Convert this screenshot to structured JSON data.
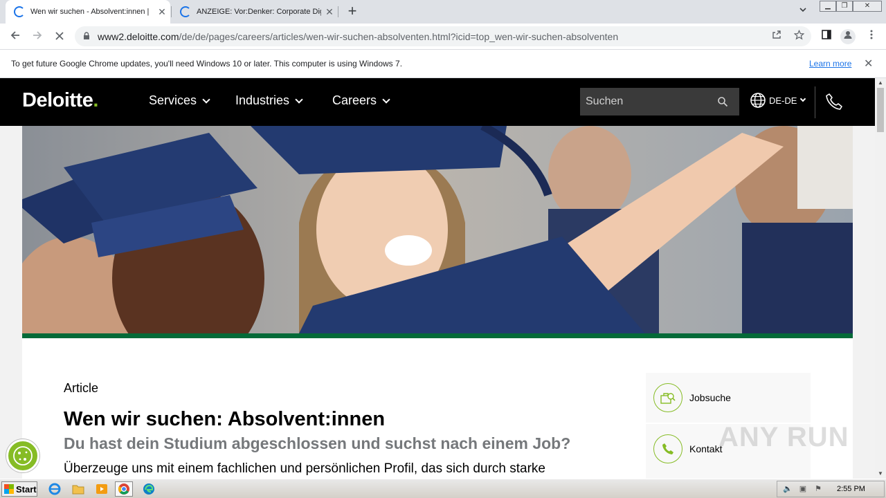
{
  "browser": {
    "tabs": [
      {
        "title": "Wen wir suchen - Absolvent:innen | ",
        "close": "✕"
      },
      {
        "title": "ANZEIGE: Vor:Denker: Corporate Dig",
        "close": "✕"
      }
    ],
    "new_tab": "+",
    "url_host": "www2.deloitte.com",
    "url_path": "/de/de/pages/careers/articles/wen-wir-suchen-absolventen.html?icid=top_wen-wir-suchen-absolventen",
    "infobar": {
      "message": "To get future Google Chrome updates, you'll need Windows 10 or later. This computer is using Windows 7.",
      "link": "Learn more"
    }
  },
  "site": {
    "logo": "Deloitte",
    "logo_dot": ".",
    "nav": [
      "Services",
      "Industries",
      "Careers"
    ],
    "search_placeholder": "Suchen",
    "language": "DE-DE",
    "brand_green": "#86bc25",
    "accent_bar": "#046a38"
  },
  "article": {
    "eyebrow": "Article",
    "title": "Wen wir suchen: Absolvent:innen",
    "subtitle": "Du hast dein Studium abgeschlossen und suchst nach einem Job?",
    "lead": "Überzeuge uns mit einem fachlichen und persönlichen Profil, das sich durch starke"
  },
  "sidebar": {
    "items": [
      {
        "label": "Jobsuche",
        "icon": "job-search-icon"
      },
      {
        "label": "Kontakt",
        "icon": "phone-icon"
      }
    ]
  },
  "watermark": "ANY RUN",
  "taskbar": {
    "start": "Start",
    "clock": "2:55 PM"
  }
}
